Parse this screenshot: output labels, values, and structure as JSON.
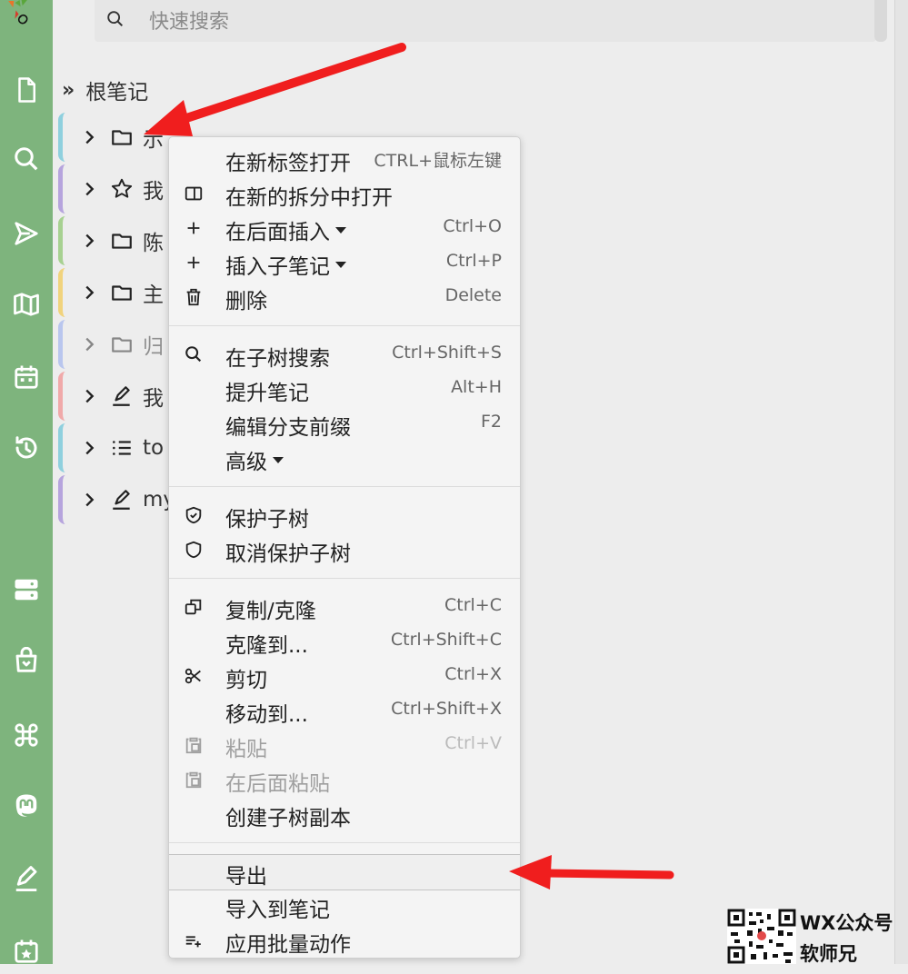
{
  "search": {
    "placeholder": "快速搜索"
  },
  "tree": {
    "root_label": "根笔记",
    "nodes": [
      {
        "label": "示",
        "icon": "folder-icon",
        "color": "#8fd0de"
      },
      {
        "label": "我",
        "icon": "star-icon",
        "color": "#b6a4dd"
      },
      {
        "label": "陈",
        "icon": "folder-icon",
        "color": "#a7d191"
      },
      {
        "label": "主",
        "icon": "folder-icon",
        "color": "#f1d37d"
      },
      {
        "label": "归",
        "icon": "folder-icon",
        "color": "#b9c6ee"
      },
      {
        "label": "我",
        "icon": "pen-icon",
        "color": "#f0a9a9"
      },
      {
        "label": "to",
        "icon": "list-icon",
        "color": "#8fd0de"
      },
      {
        "label": "my",
        "icon": "pen-icon",
        "color": "#b6a4dd"
      }
    ]
  },
  "menu": {
    "items": [
      {
        "label": "在新标签打开",
        "key": "CTRL+鼠标左键"
      },
      {
        "label": "在新的拆分中打开",
        "key": ""
      },
      {
        "label": "在后面插入",
        "key": "Ctrl+O"
      },
      {
        "label": "插入子笔记",
        "key": "Ctrl+P"
      },
      {
        "label": "删除",
        "key": "Delete"
      },
      {
        "label": "在子树搜索",
        "key": "Ctrl+Shift+S"
      },
      {
        "label": "提升笔记",
        "key": "Alt+H"
      },
      {
        "label": "编辑分支前缀",
        "key": "F2"
      },
      {
        "label": "高级",
        "key": ""
      },
      {
        "label": "保护子树",
        "key": ""
      },
      {
        "label": "取消保护子树",
        "key": ""
      },
      {
        "label": "复制/克隆",
        "key": "Ctrl+C"
      },
      {
        "label": "克隆到...",
        "key": "Ctrl+Shift+C"
      },
      {
        "label": "剪切",
        "key": "Ctrl+X"
      },
      {
        "label": "移动到...",
        "key": "Ctrl+Shift+X"
      },
      {
        "label": "粘贴",
        "key": "Ctrl+V"
      },
      {
        "label": "在后面粘贴",
        "key": ""
      },
      {
        "label": "创建子树副本",
        "key": ""
      },
      {
        "label": "导出",
        "key": ""
      },
      {
        "label": "导入到笔记",
        "key": ""
      },
      {
        "label": "应用批量动作",
        "key": ""
      }
    ]
  },
  "watermark": {
    "line1": "WX公众号",
    "line2": "软师兄"
  },
  "colors": {
    "launcher": "#7eb47d",
    "annotation_arrow": "#f01e1e"
  }
}
